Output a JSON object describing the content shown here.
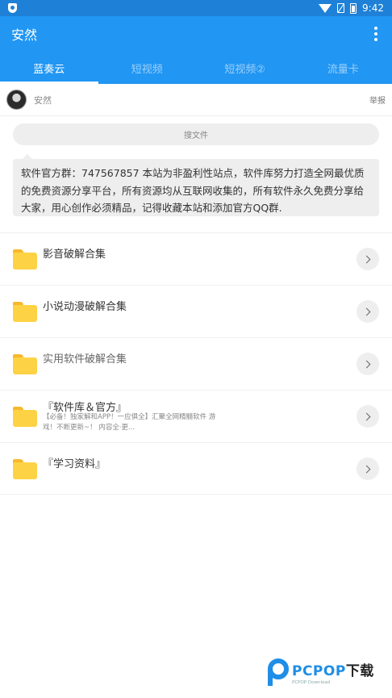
{
  "status_bar": {
    "time": "9:42"
  },
  "app_bar": {
    "title": "安然"
  },
  "tabs": [
    {
      "label": "蓝奏云",
      "active": true
    },
    {
      "label": "短视频",
      "active": false
    },
    {
      "label": "短视频②",
      "active": false
    },
    {
      "label": "流量卡",
      "active": false
    }
  ],
  "user": {
    "name": "安然",
    "report_label": "举报"
  },
  "search": {
    "placeholder": "搜文件"
  },
  "notice": {
    "text": "软件官方群：747567857 本站为非盈利性站点，软件库努力打造全网最优质的免费资源分享平台，所有资源均从互联网收集的，所有软件永久免费分享给大家，用心创作必须精品，记得收藏本站和添加官方QQ群."
  },
  "folders": [
    {
      "title": "影音破解合集",
      "desc": ""
    },
    {
      "title": "小说动漫破解合集",
      "desc": ""
    },
    {
      "title": "实用软件破解合集",
      "desc": ""
    },
    {
      "title": "『软件库＆官方』",
      "desc": "【必备！独家解和APP！一应俱全】汇聚全网精髓软件 游戏！不断更新~！ 内容全·更..."
    },
    {
      "title": "『学习资料』",
      "desc": ""
    }
  ],
  "watermark": {
    "brand": "PCPOP",
    "brand_suffix": "下载",
    "sub": "PCPOP Download"
  },
  "colors": {
    "primary": "#2196f3",
    "status_bar": "#1e81d7",
    "folder": "#fdd345"
  }
}
